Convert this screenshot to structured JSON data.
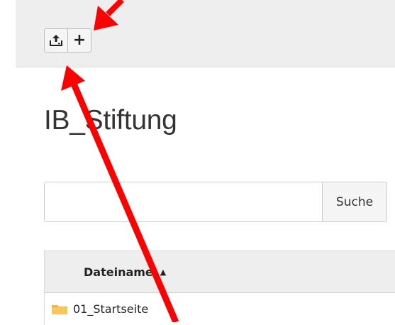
{
  "toolbar": {
    "upload_icon": "upload-icon",
    "add_icon": "plus-icon",
    "add_glyph": "+"
  },
  "page": {
    "title": "IB_Stiftung"
  },
  "search": {
    "value": "",
    "placeholder": "",
    "button_label": "Suche"
  },
  "table": {
    "columns": [
      {
        "label": "Dateiname",
        "sort": "ascending",
        "sort_glyph": "▲"
      }
    ],
    "rows": [
      {
        "name": "01_Startseite",
        "icon": "folder-icon"
      }
    ]
  },
  "annotations": {
    "arrow_color": "#ff0000"
  }
}
